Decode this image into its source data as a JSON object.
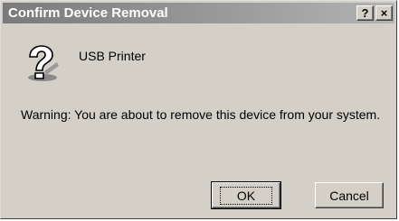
{
  "dialog": {
    "title": "Confirm Device Removal",
    "help_label": "?",
    "close_label": "×"
  },
  "device": {
    "icon": "question-mark-icon",
    "name": "USB Printer"
  },
  "message": {
    "warning": "Warning: You are about to remove this device from your system."
  },
  "buttons": {
    "ok_label": "OK",
    "cancel_label": "Cancel"
  }
}
